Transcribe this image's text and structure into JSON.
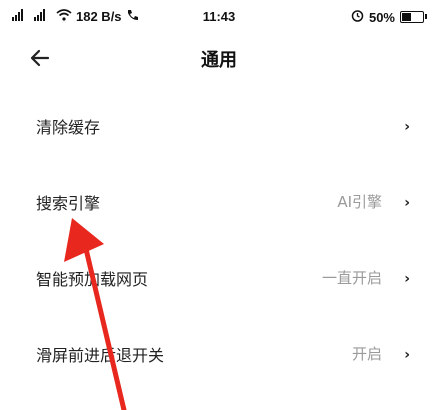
{
  "status_bar": {
    "signal_1": "⁴ᴳ",
    "signal_2": "²ᴳ",
    "net_speed": "182 B/s",
    "time": "11:43",
    "battery_pct": "50%",
    "battery_level": 0.5
  },
  "header": {
    "back_icon": "back-arrow-icon",
    "title": "通用"
  },
  "settings": [
    {
      "label": "清除缓存",
      "value": ""
    },
    {
      "label": "搜索引擎",
      "value": "AI引擎"
    },
    {
      "label": "智能预加载网页",
      "value": "一直开启"
    },
    {
      "label": "滑屏前进后退开关",
      "value": "开启"
    }
  ],
  "overlay": {
    "annotation": "red-arrow",
    "color": "#e8281e"
  }
}
